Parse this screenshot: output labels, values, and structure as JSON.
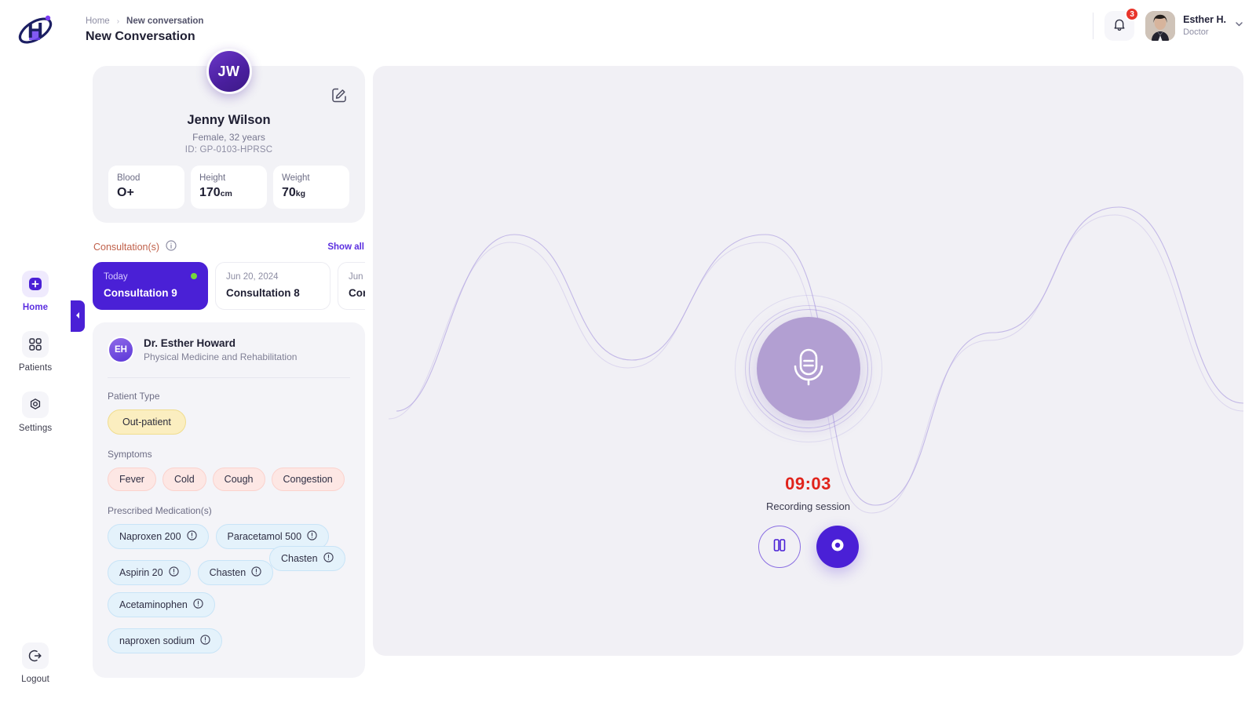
{
  "app": {
    "logo_name": "hospital-logo",
    "accent": "#4a20d6",
    "danger": "#e0231b",
    "success": "#76d63c"
  },
  "header": {
    "breadcrumb_home": "Home",
    "breadcrumb_sep": "›",
    "breadcrumb_current": "New conversation",
    "page_title": "New Conversation",
    "notifications_count": "3",
    "user_name": "Esther H.",
    "user_role": "Doctor"
  },
  "sidebar": {
    "items": [
      {
        "label": "Home",
        "icon": "plus-square-icon",
        "active": true
      },
      {
        "label": "Patients",
        "icon": "grid-icon",
        "active": false
      },
      {
        "label": "Settings",
        "icon": "gear-hex-icon",
        "active": false
      }
    ],
    "logout_label": "Logout",
    "logout_icon": "logout-icon",
    "collapse_icon": "chevron-left-icon"
  },
  "patient": {
    "initials": "JW",
    "name": "Jenny Wilson",
    "sub": "Female, 32 years",
    "id": "ID: GP-0103-HPRSC",
    "edit_icon": "edit-pencil-icon",
    "vitals": [
      {
        "label": "Blood",
        "value": "O+",
        "unit": ""
      },
      {
        "label": "Height",
        "value": "170",
        "unit": "cm"
      },
      {
        "label": "Weight",
        "value": "70",
        "unit": "kg"
      }
    ]
  },
  "consultations": {
    "title": "Consultation(s)",
    "info_icon": "info-icon",
    "show_all": "Show all",
    "cards": [
      {
        "date": "Today",
        "name": "Consultation 9",
        "active": true,
        "dot": true
      },
      {
        "date": "Jun 20, 2024",
        "name": "Consultation 8",
        "active": false,
        "dot": false
      },
      {
        "date": "Jun",
        "name": "Con",
        "active": false,
        "dot": false
      }
    ]
  },
  "detail": {
    "doctor_initials": "EH",
    "doctor_name": "Dr. Esther Howard",
    "doctor_specialty": "Physical Medicine and Rehabilitation",
    "patient_type_label": "Patient Type",
    "patient_type_value": "Out-patient",
    "symptoms_label": "Symptoms",
    "symptoms": [
      "Fever",
      "Cold",
      "Cough",
      "Congestion"
    ],
    "medications_label": "Prescribed Medication(s)",
    "medications_row1": [
      "Naproxen 200",
      "Paracetamol 500"
    ],
    "medications_row2": [
      "Aspirin 20",
      "Chasten"
    ],
    "medication_float": "Chasten",
    "medications_row3": [
      "Acetaminophen"
    ],
    "medications_row4": [
      "naproxen sodium"
    ],
    "med_info_icon": "info-circle-icon"
  },
  "recorder": {
    "mic_icon": "microphone-icon",
    "timer": "09:03",
    "status": "Recording session",
    "pause_label": "pause-button",
    "stop_label": "stop-button"
  }
}
